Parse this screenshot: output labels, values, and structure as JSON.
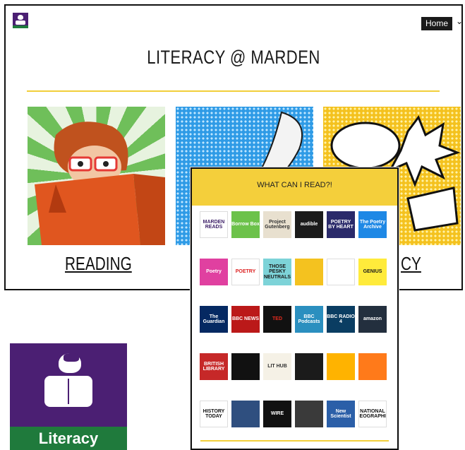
{
  "header": {
    "home_label": "Home",
    "title": "LITERACY @ MARDEN"
  },
  "tiles": [
    {
      "label": "READING"
    },
    {
      "label": ""
    },
    {
      "label": "CY"
    }
  ],
  "popup": {
    "title": "WHAT CAN I READ?!",
    "subtitle": "",
    "resources": [
      {
        "name": "MARDEN READS",
        "bg": "#ffffff",
        "fg": "#3b1d66"
      },
      {
        "name": "Borrow Box",
        "bg": "#6cc24a",
        "fg": "#ffffff"
      },
      {
        "name": "Project Gutenberg",
        "bg": "#e8e0cf",
        "fg": "#333333"
      },
      {
        "name": "audible",
        "bg": "#1b1b1b",
        "fg": "#ffffff"
      },
      {
        "name": "POETRY BY HEART",
        "bg": "#2a2a6a",
        "fg": "#ffffff"
      },
      {
        "name": "The Poetry Archive",
        "bg": "#1e88e5",
        "fg": "#ffffff"
      },
      {
        "name": "Poetry",
        "bg": "#e040a0",
        "fg": "#ffffff"
      },
      {
        "name": "POETRY",
        "bg": "#ffffff",
        "fg": "#d22"
      },
      {
        "name": "THOSE PESKY NEUTRALS",
        "bg": "#7dd3d8",
        "fg": "#1a1a1a"
      },
      {
        "name": "",
        "bg": "#f4c21f",
        "fg": "#1a1a1a"
      },
      {
        "name": "",
        "bg": "#ffffff",
        "fg": "#1a1a1a"
      },
      {
        "name": "GENIUS",
        "bg": "#ffeb3b",
        "fg": "#1a1a1a"
      },
      {
        "name": "The Guardian",
        "bg": "#052962",
        "fg": "#ffffff"
      },
      {
        "name": "BBC NEWS",
        "bg": "#bb1919",
        "fg": "#ffffff"
      },
      {
        "name": "TED",
        "bg": "#111111",
        "fg": "#e62b1e"
      },
      {
        "name": "BBC Podcasts",
        "bg": "#2b8fbf",
        "fg": "#ffffff"
      },
      {
        "name": "BBC RADIO 4",
        "bg": "#0a3d62",
        "fg": "#ffffff"
      },
      {
        "name": "amazon",
        "bg": "#232f3e",
        "fg": "#ffffff"
      },
      {
        "name": "BRITISH LIBRARY",
        "bg": "#c62828",
        "fg": "#ffffff"
      },
      {
        "name": "",
        "bg": "#111111",
        "fg": "#f4c21f"
      },
      {
        "name": "LIT HUB",
        "bg": "#f5f1e6",
        "fg": "#333333"
      },
      {
        "name": "",
        "bg": "#1b1b1b",
        "fg": "#f4e04d"
      },
      {
        "name": "",
        "bg": "#ffb300",
        "fg": "#1a1a1a"
      },
      {
        "name": "",
        "bg": "#ff7a1a",
        "fg": "#ffffff"
      },
      {
        "name": "HISTORY TODAY",
        "bg": "#ffffff",
        "fg": "#111111"
      },
      {
        "name": "",
        "bg": "#2f4f7f",
        "fg": "#ffffff"
      },
      {
        "name": "WIRE",
        "bg": "#111111",
        "fg": "#ffffff"
      },
      {
        "name": "",
        "bg": "#3a3a3a",
        "fg": "#ffffff"
      },
      {
        "name": "New Scientist",
        "bg": "#2b5fa8",
        "fg": "#ffffff"
      },
      {
        "name": "NATIONAL GEOGRAPHIC",
        "bg": "#ffffff",
        "fg": "#111111"
      }
    ]
  },
  "badge": {
    "label": "Literacy"
  },
  "colors": {
    "brand_purple": "#4b1f73",
    "brand_green": "#1f7a3c",
    "accent_yellow": "#f4cf3b"
  }
}
